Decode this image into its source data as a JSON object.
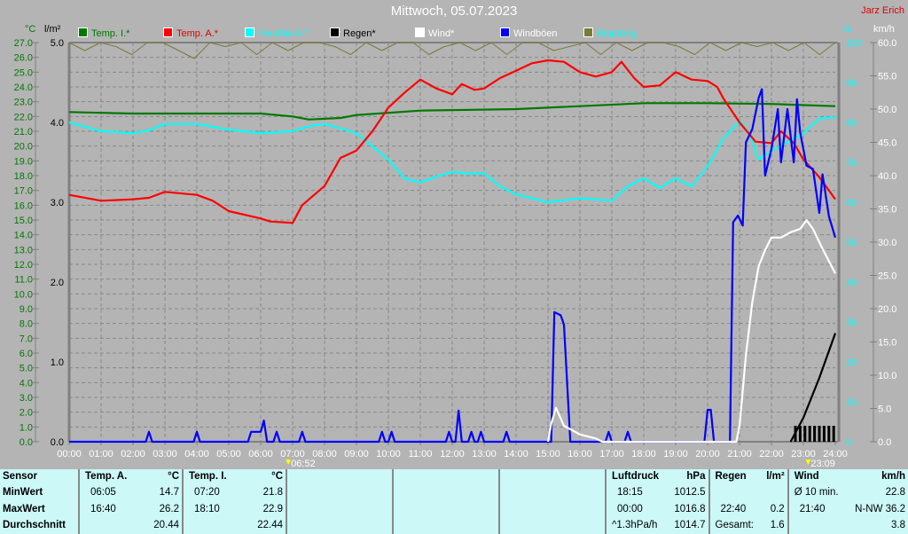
{
  "header": {
    "title": "Mittwoch, 05.07.2023",
    "author": "Jarz Erich"
  },
  "axes": {
    "left_unit": "°C",
    "rain_unit": "l/m²",
    "hum_unit": "%",
    "wind_unit": "km/h"
  },
  "markers": {
    "sunrise": "06:52",
    "sunset": "23:09"
  },
  "legend": [
    {
      "label": "Temp. I.*",
      "color": "#007800",
      "text": "#007800"
    },
    {
      "label": "Temp. A.*",
      "color": "#ff0000",
      "text": "#e00000"
    },
    {
      "label": "Feuchte A.*",
      "color": "#00ffff",
      "text": "#00ffff"
    },
    {
      "label": "Regen*",
      "color": "#000000",
      "text": "#000000"
    },
    {
      "label": "Wind*",
      "color": "#ffffff",
      "text": "#ffffff"
    },
    {
      "label": "Windböen",
      "color": "#0000ff",
      "text": "#ffffff"
    },
    {
      "label": "Empfang",
      "color": "#7a7a3a",
      "text": "#00ffff"
    }
  ],
  "chart_data": {
    "type": "line",
    "title": "Mittwoch, 05.07.2023",
    "x_ticks": [
      "00:00",
      "01:00",
      "02:00",
      "03:00",
      "04:00",
      "05:00",
      "06:00",
      "07:00",
      "08:00",
      "09:00",
      "10:00",
      "11:00",
      "12:00",
      "13:00",
      "14:00",
      "15:00",
      "16:00",
      "17:00",
      "18:00",
      "19:00",
      "20:00",
      "21:00",
      "22:00",
      "23:00",
      "24:00"
    ],
    "y_temp_ticks": [
      "0.0",
      "1.0",
      "2.0",
      "3.0",
      "4.0",
      "5.0",
      "6.0",
      "7.0",
      "8.0",
      "9.0",
      "10.0",
      "11.0",
      "12.0",
      "13.0",
      "14.0",
      "15.0",
      "16.0",
      "17.0",
      "18.0",
      "19.0",
      "20.0",
      "21.0",
      "22.0",
      "23.0",
      "24.0",
      "25.0",
      "26.0",
      "27.0"
    ],
    "y_rain_ticks": [
      "0.0",
      "1.0",
      "2.0",
      "3.0",
      "4.0",
      "5.0"
    ],
    "y_hum_ticks": [
      "0",
      "10",
      "20",
      "30",
      "40",
      "50",
      "60",
      "70",
      "80",
      "90",
      "100"
    ],
    "y_wind_ticks": [
      "0.0",
      "5.0",
      "10.0",
      "15.0",
      "20.0",
      "25.0",
      "30.0",
      "35.0",
      "40.0",
      "45.0",
      "50.0",
      "55.0",
      "60.0"
    ],
    "ranges": {
      "temp": [
        0,
        27
      ],
      "rain": [
        0,
        5
      ],
      "hum": [
        0,
        100
      ],
      "wind": [
        0,
        60
      ],
      "x": [
        0,
        24
      ]
    },
    "series": [
      {
        "name": "Temp. I.*",
        "axis": "temp",
        "color": "#007800",
        "points": [
          [
            0,
            22.3
          ],
          [
            1,
            22.25
          ],
          [
            2,
            22.2
          ],
          [
            4,
            22.2
          ],
          [
            6,
            22.2
          ],
          [
            7,
            22
          ],
          [
            7.5,
            21.8
          ],
          [
            8.5,
            21.9
          ],
          [
            9,
            22.1
          ],
          [
            11,
            22.4
          ],
          [
            14,
            22.5
          ],
          [
            16,
            22.7
          ],
          [
            18,
            22.9
          ],
          [
            20,
            22.9
          ],
          [
            22,
            22.85
          ],
          [
            24,
            22.7
          ]
        ]
      },
      {
        "name": "Feuchte A.*",
        "axis": "hum",
        "color": "#00ffff",
        "points": [
          [
            0,
            80
          ],
          [
            1,
            77.8
          ],
          [
            2,
            77.3
          ],
          [
            2.5,
            78
          ],
          [
            3,
            79.6
          ],
          [
            4,
            79.6
          ],
          [
            5,
            78.2
          ],
          [
            6,
            77.3
          ],
          [
            7,
            77.8
          ],
          [
            7.5,
            79
          ],
          [
            8,
            79.6
          ],
          [
            8.5,
            78.5
          ],
          [
            9,
            77.3
          ],
          [
            9.5,
            74
          ],
          [
            10,
            70.7
          ],
          [
            10.5,
            66
          ],
          [
            11,
            65
          ],
          [
            11.5,
            66.4
          ],
          [
            12,
            67.6
          ],
          [
            12.5,
            67.2
          ],
          [
            13,
            67.2
          ],
          [
            13.5,
            64
          ],
          [
            14,
            62
          ],
          [
            15,
            60
          ],
          [
            16,
            61
          ],
          [
            17,
            60.4
          ],
          [
            17.5,
            64
          ],
          [
            18,
            66
          ],
          [
            18.5,
            63.6
          ],
          [
            19,
            66
          ],
          [
            19.5,
            64
          ],
          [
            20,
            69
          ],
          [
            20.5,
            76
          ],
          [
            21,
            80.4
          ],
          [
            21.3,
            77.3
          ],
          [
            21.6,
            70.7
          ],
          [
            22,
            72.9
          ],
          [
            22.5,
            75
          ],
          [
            23,
            77.3
          ],
          [
            23.5,
            81
          ],
          [
            24,
            81.3
          ]
        ]
      },
      {
        "name": "Temp. A.*",
        "axis": "temp",
        "color": "#ff0000",
        "points": [
          [
            0,
            16.7
          ],
          [
            1,
            16.3
          ],
          [
            2,
            16.4
          ],
          [
            2.5,
            16.5
          ],
          [
            3,
            16.9
          ],
          [
            4,
            16.7
          ],
          [
            4.5,
            16.3
          ],
          [
            5,
            15.6
          ],
          [
            6,
            15.1
          ],
          [
            6.3,
            14.9
          ],
          [
            7,
            14.8
          ],
          [
            7.3,
            16
          ],
          [
            8,
            17.3
          ],
          [
            8.5,
            19.2
          ],
          [
            9,
            19.7
          ],
          [
            9.5,
            21
          ],
          [
            10,
            22.6
          ],
          [
            10.5,
            23.6
          ],
          [
            11,
            24.5
          ],
          [
            11.5,
            23.9
          ],
          [
            12,
            23.5
          ],
          [
            12.3,
            24.2
          ],
          [
            12.7,
            23.8
          ],
          [
            13,
            23.9
          ],
          [
            13.5,
            24.6
          ],
          [
            14,
            25.1
          ],
          [
            14.5,
            25.6
          ],
          [
            15,
            25.8
          ],
          [
            15.5,
            25.7
          ],
          [
            16,
            25
          ],
          [
            16.5,
            24.7
          ],
          [
            17,
            25
          ],
          [
            17.3,
            25.7
          ],
          [
            17.7,
            24.6
          ],
          [
            18,
            24
          ],
          [
            18.5,
            24.1
          ],
          [
            19,
            25
          ],
          [
            19.5,
            24.5
          ],
          [
            20,
            24.4
          ],
          [
            20.3,
            24
          ],
          [
            20.5,
            23.2
          ],
          [
            21,
            21.6
          ],
          [
            21.5,
            20.3
          ],
          [
            22,
            20.2
          ],
          [
            22.3,
            21
          ],
          [
            22.7,
            20.2
          ],
          [
            23,
            19.1
          ],
          [
            23.5,
            17.9
          ],
          [
            24,
            16.4
          ]
        ]
      },
      {
        "name": "Windböen",
        "axis": "wind",
        "color": "#0000ff",
        "points": [
          [
            0,
            0
          ],
          [
            2.4,
            0
          ],
          [
            2.5,
            1.5
          ],
          [
            2.6,
            0
          ],
          [
            3.9,
            0
          ],
          [
            4,
            1.5
          ],
          [
            4.1,
            0
          ],
          [
            5.6,
            0
          ],
          [
            5.7,
            1.5
          ],
          [
            6,
            1.5
          ],
          [
            6.1,
            3.2
          ],
          [
            6.2,
            0
          ],
          [
            6.4,
            0
          ],
          [
            6.5,
            1.5
          ],
          [
            6.6,
            0
          ],
          [
            7.2,
            0
          ],
          [
            7.3,
            1.5
          ],
          [
            7.4,
            0
          ],
          [
            9.7,
            0
          ],
          [
            9.8,
            1.5
          ],
          [
            9.9,
            0
          ],
          [
            10,
            0
          ],
          [
            10.1,
            1.5
          ],
          [
            10.2,
            0
          ],
          [
            11.8,
            0
          ],
          [
            11.9,
            1.5
          ],
          [
            12,
            0
          ],
          [
            12.1,
            0
          ],
          [
            12.2,
            4.7
          ],
          [
            12.3,
            0
          ],
          [
            12.5,
            0
          ],
          [
            12.6,
            1.5
          ],
          [
            12.7,
            0
          ],
          [
            12.8,
            0
          ],
          [
            12.9,
            1.5
          ],
          [
            13,
            0
          ],
          [
            13.6,
            0
          ],
          [
            13.7,
            1.5
          ],
          [
            13.8,
            0
          ],
          [
            15.1,
            0
          ],
          [
            15.2,
            19.5
          ],
          [
            15.4,
            19
          ],
          [
            15.5,
            17.6
          ],
          [
            15.7,
            0
          ],
          [
            16.8,
            0
          ],
          [
            16.9,
            1.5
          ],
          [
            17,
            0
          ],
          [
            17.4,
            0
          ],
          [
            17.5,
            1.5
          ],
          [
            17.6,
            0
          ],
          [
            19.9,
            0
          ],
          [
            20,
            4.8
          ],
          [
            20.1,
            4.8
          ],
          [
            20.2,
            0
          ],
          [
            20.7,
            0
          ],
          [
            20.8,
            33
          ],
          [
            20.95,
            34
          ],
          [
            21.1,
            32.5
          ],
          [
            21.2,
            45
          ],
          [
            21.4,
            47
          ],
          [
            21.6,
            51.7
          ],
          [
            21.7,
            53
          ],
          [
            21.8,
            40
          ],
          [
            22,
            44
          ],
          [
            22.2,
            50
          ],
          [
            22.3,
            42
          ],
          [
            22.5,
            50
          ],
          [
            22.7,
            42
          ],
          [
            22.8,
            51.5
          ],
          [
            22.9,
            46.5
          ],
          [
            23.1,
            41.5
          ],
          [
            23.3,
            41
          ],
          [
            23.5,
            34.4
          ],
          [
            23.6,
            40.2
          ],
          [
            23.8,
            33.9
          ],
          [
            24,
            30.7
          ]
        ]
      },
      {
        "name": "Wind*",
        "axis": "wind",
        "color": "#ffffff",
        "points": [
          [
            15,
            0
          ],
          [
            15.1,
            2.7
          ],
          [
            15.25,
            5.1
          ],
          [
            15.5,
            2.4
          ],
          [
            16,
            1.1
          ],
          [
            16.5,
            0.5
          ],
          [
            16.7,
            0
          ],
          [
            20.9,
            0
          ],
          [
            21,
            2.4
          ],
          [
            21.2,
            13
          ],
          [
            21.4,
            21
          ],
          [
            21.6,
            26.4
          ],
          [
            21.8,
            28.8
          ],
          [
            22,
            30.7
          ],
          [
            22.3,
            30.7
          ],
          [
            22.6,
            31.5
          ],
          [
            22.9,
            32
          ],
          [
            23.1,
            33.3
          ],
          [
            23.3,
            32
          ],
          [
            23.6,
            29
          ],
          [
            24,
            25.3
          ]
        ]
      },
      {
        "name": "Regen*",
        "axis": "rain",
        "color": "#000000",
        "points": [
          [
            22.6,
            0
          ],
          [
            23,
            0.3
          ],
          [
            23.5,
            0.8
          ],
          [
            24,
            1.36
          ]
        ],
        "bars": [
          22.75,
          22.9,
          23.05,
          23.2,
          23.35,
          23.5,
          23.65,
          23.8,
          23.95
        ],
        "bar_value": 0.2
      },
      {
        "name": "Empfang",
        "axis": "hum",
        "color": "#7a7a3a",
        "values": [
          100,
          98,
          100,
          99,
          97,
          100,
          100,
          98,
          96,
          100,
          99,
          100,
          97,
          100,
          98,
          100,
          100,
          99,
          97,
          100,
          98,
          100,
          100,
          97,
          99,
          100,
          98,
          100,
          97,
          100,
          100,
          98,
          99,
          100,
          97,
          100,
          98,
          100,
          100,
          99,
          97,
          100,
          98,
          100,
          99,
          100,
          98,
          100,
          97,
          100
        ]
      }
    ]
  },
  "stats": {
    "labels": [
      "Sensor",
      "MinWert",
      "MaxWert",
      "Durchschnitt"
    ],
    "temp_a": {
      "title": "Temp. A.",
      "unit": "°C",
      "min_time": "06:05",
      "min": "14.7",
      "max_time": "16:40",
      "max": "26.2",
      "avg": "20.44"
    },
    "temp_i": {
      "title": "Temp. I.",
      "unit": "°C",
      "min_time": "07:20",
      "min": "21.8",
      "max_time": "18:10",
      "max": "22.9",
      "avg": "22.44"
    },
    "pressure": {
      "title": "Luftdruck",
      "unit": "hPa",
      "r1a": "18:15",
      "r1b": "1012.5",
      "r2a": "00:00",
      "r2b": "1016.8",
      "r3a": "^1.3hPa/h",
      "r3b": "1014.7"
    },
    "rain": {
      "title": "Regen",
      "unit": "l/m²",
      "r2a": "22:40",
      "r2b": "0.2",
      "r3a": "Gesamt:",
      "r3b": "1.6"
    },
    "wind": {
      "title": "Wind",
      "unit": "km/h",
      "r1a": "Ø 10 min.",
      "r1b": "22.8",
      "r2a": "21:40",
      "r2b": "N-NW 36.2",
      "r3b": "3.8"
    }
  }
}
